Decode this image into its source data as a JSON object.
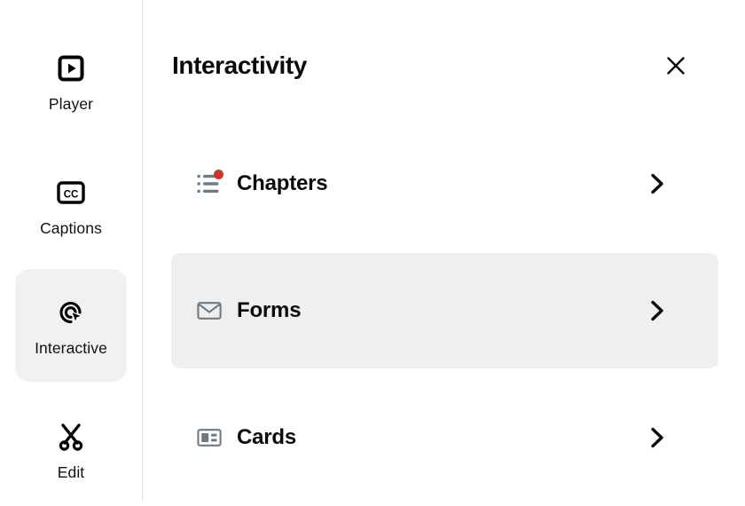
{
  "sidebar": {
    "items": [
      {
        "id": "player",
        "label": "Player",
        "icon": "play-square-icon",
        "active": false
      },
      {
        "id": "captions",
        "label": "Captions",
        "icon": "closed-caption-icon",
        "active": false
      },
      {
        "id": "interactive",
        "label": "Interactive",
        "icon": "ads-click-icon",
        "active": true
      },
      {
        "id": "edit",
        "label": "Edit",
        "icon": "scissors-icon",
        "active": false
      }
    ]
  },
  "panel": {
    "title": "Interactivity",
    "close_icon": "close-icon",
    "rows": [
      {
        "id": "chapters",
        "label": "Chapters",
        "icon": "list-icon",
        "badge": true,
        "badge_color": "#d0342c",
        "chevron": "chevron-right-icon",
        "highlighted": false
      },
      {
        "id": "forms",
        "label": "Forms",
        "icon": "mail-icon",
        "badge": false,
        "badge_color": "",
        "chevron": "chevron-right-icon",
        "highlighted": true
      },
      {
        "id": "cards",
        "label": "Cards",
        "icon": "contact-card-icon",
        "badge": false,
        "badge_color": "",
        "chevron": "chevron-right-icon",
        "highlighted": false
      }
    ]
  },
  "colors": {
    "background": "#ffffff",
    "divider": "#dfe2e5",
    "active_pill": "#f1f1f4",
    "row_highlight": "#efefef",
    "icon_gray": "#707a85",
    "text": "#0b0b0b",
    "badge_red": "#d0342c"
  }
}
